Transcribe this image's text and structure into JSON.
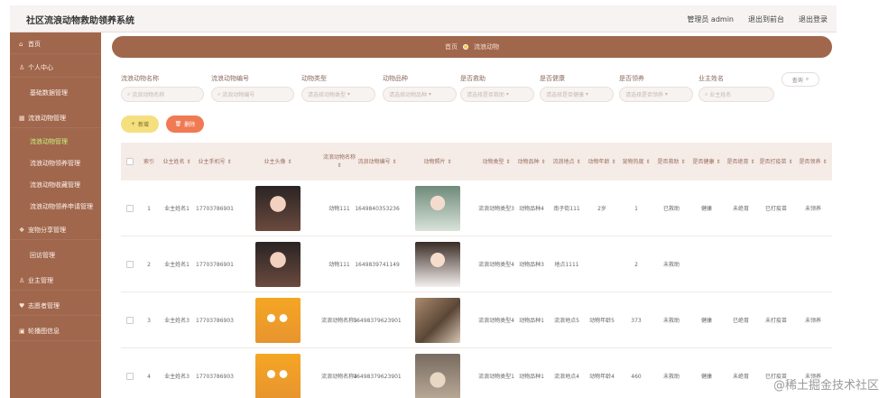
{
  "app": {
    "title": "社区流浪动物救助领养系统"
  },
  "top_links": [
    "管理员 admin",
    "退出到前台",
    "退出登录"
  ],
  "sidebar": {
    "items": [
      {
        "label": "首页",
        "icon": "home-icon"
      },
      {
        "label": "个人中心",
        "icon": "user-icon"
      },
      {
        "label": "基础数据管理",
        "sub": true
      },
      {
        "label": "流浪动物管理",
        "icon": "grid-icon"
      },
      {
        "label": "流浪动物管理",
        "sub": true,
        "active": true
      },
      {
        "label": "流浪动物领养管理",
        "sub": true
      },
      {
        "label": "流浪动物收藏管理",
        "sub": true
      },
      {
        "label": "流浪动物领养申请管理",
        "sub": true
      },
      {
        "label": "宠物分享管理",
        "icon": "share-icon"
      },
      {
        "label": "回访管理",
        "sub": true
      },
      {
        "label": "业主管理",
        "icon": "user-icon"
      },
      {
        "label": "志愿者管理",
        "icon": "heart-icon"
      },
      {
        "label": "轮播图信息",
        "icon": "image-icon"
      }
    ]
  },
  "breadcrumb": {
    "home": "首页",
    "current": "流浪动物"
  },
  "filters": [
    {
      "label": "流浪动物名称",
      "placeholder": "流浪动物名称"
    },
    {
      "label": "流浪动物编号",
      "placeholder": "流浪动物编号"
    },
    {
      "label": "动物类型",
      "placeholder": "请选择动物类型"
    },
    {
      "label": "动物品种",
      "placeholder": "请选择动物品种"
    },
    {
      "label": "是否救助",
      "placeholder": "请选择是否救助"
    },
    {
      "label": "是否健康",
      "placeholder": "请选择是否健康"
    },
    {
      "label": "是否领养",
      "placeholder": "请选择是否领养"
    },
    {
      "label": "业主姓名",
      "placeholder": "业主姓名"
    }
  ],
  "search_label": "查询",
  "actions": {
    "add": "新增",
    "delete": "删除"
  },
  "table": {
    "columns": [
      "",
      "索引",
      "业主姓名 ⇕",
      "业主手机号 ⇕",
      "业主头像 ⇕",
      "流浪动物名称 ⇕",
      "流浪动物编号 ⇕",
      "动物照片 ⇕",
      "动物类型 ⇕",
      "动物品种 ⇕",
      "流浪地点 ⇕",
      "动物年龄 ⇕",
      "宠物热度 ⇕",
      "是否救助 ⇕",
      "是否健康 ⇕",
      "是否绝育 ⇕",
      "是否打疫苗 ⇕",
      "是否领养 ⇕"
    ],
    "rows": [
      {
        "index": "1",
        "owner": "业主姓名1",
        "phone": "17703786901",
        "avatar": "girl",
        "name": "动物111",
        "code": "1649840353236",
        "photo": "girl",
        "type": "流浪动物类型3",
        "breed": "动物品种4",
        "place": "南子街111",
        "age": "2岁",
        "heat": "1",
        "rescued": "已救助",
        "healthy": "健康",
        "neutered": "未绝育",
        "vaccine": "已打疫苗",
        "adopted": "未领养"
      },
      {
        "index": "2",
        "owner": "业主姓名1",
        "phone": "17703786901",
        "avatar": "girl",
        "name": "动物111",
        "code": "1649839741149",
        "photo": "boy",
        "type": "流浪动物类型4",
        "breed": "动物品种3",
        "place": "地点1111",
        "age": "",
        "heat": "2",
        "rescued": "未救助",
        "healthy": "",
        "neutered": "",
        "vaccine": "",
        "adopted": ""
      },
      {
        "index": "3",
        "owner": "业主姓名3",
        "phone": "17703786903",
        "avatar": "cartoon",
        "name": "流浪动物名称5",
        "code": "16498379623901",
        "photo": "room",
        "type": "流浪动物类型4",
        "breed": "动物品种1",
        "place": "流浪地点5",
        "age": "动物年龄5",
        "heat": "373",
        "rescued": "未救助",
        "healthy": "健康",
        "neutered": "已绝育",
        "vaccine": "未打疫苗",
        "adopted": "未领养"
      },
      {
        "index": "4",
        "owner": "业主姓名3",
        "phone": "17703786903",
        "avatar": "cartoon",
        "name": "流浪动物名称4",
        "code": "16498379623901",
        "photo": "dog",
        "type": "流浪动物类型1",
        "breed": "动物品种1",
        "place": "流浪地点4",
        "age": "动物年龄4",
        "heat": "460",
        "rescued": "未救助",
        "healthy": "健康",
        "neutered": "未绝育",
        "vaccine": "已打疫苗",
        "adopted": "未领养"
      }
    ]
  },
  "watermark": "@稀土掘金技术社区",
  "colors": {
    "sidebar": "#a0674d",
    "accent_add": "#f4e07f",
    "accent_delete": "#f07a52",
    "header_row": "#f5ece8"
  }
}
